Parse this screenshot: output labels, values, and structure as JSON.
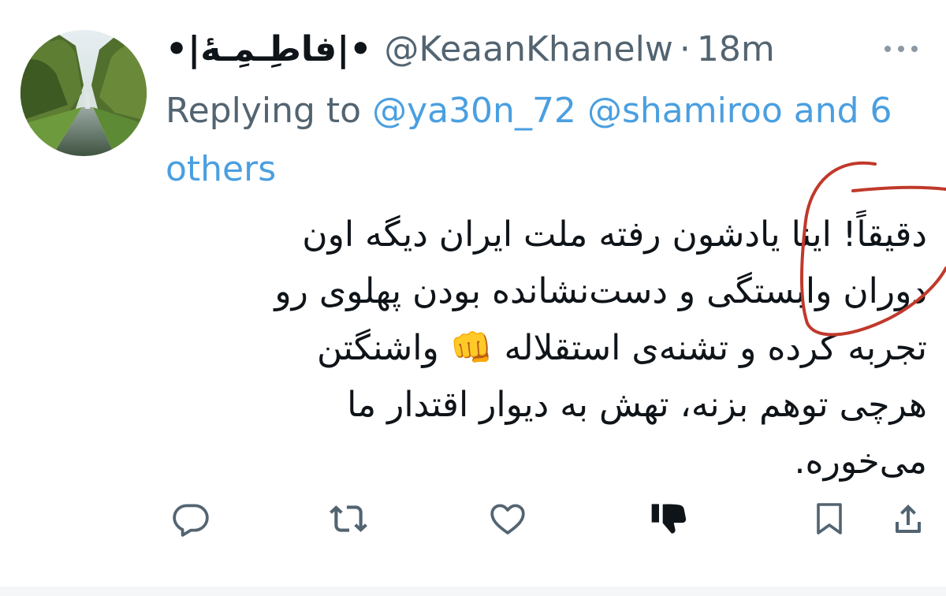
{
  "tweet": {
    "display_name": "•|فاطِـمِـۀ|•",
    "handle": "@KeaanKhanelw",
    "separator": "·",
    "time": "18m",
    "reply": {
      "prefix": "Replying to",
      "mention_1": "@ya30n_72",
      "mention_2": "@shamiroo",
      "connector": "and",
      "others": "6 others"
    },
    "text_lines": [
      "دقیقاً! اینا یادشون رفته ملت ایران دیگه اون",
      "دوران وابستگی و دست‌نشانده بودن پهلوی رو",
      "تجربه کرده و تشنه‌ی استقلاله 👊 واشنگتن",
      "هرچی توهم بزنه، تهش به دیوار اقتدار ما",
      "می‌خوره."
    ]
  },
  "icons": {
    "more": "more-horizontal-icon",
    "reply": "reply-bubble-icon",
    "retweet": "retweet-icon",
    "like": "heart-icon",
    "dislike": "thumbs-down-icon",
    "bookmark": "bookmark-icon",
    "share": "share-icon"
  },
  "colors": {
    "text": "#0f1419",
    "secondary": "#536471",
    "link": "#4a9fe0",
    "annotation": "#c0392b"
  }
}
